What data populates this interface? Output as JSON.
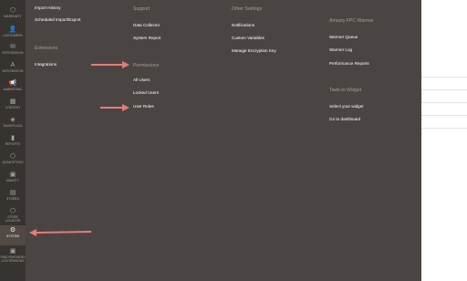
{
  "sidebar": {
    "items": [
      {
        "label": "WARRANTY",
        "icon": "hexagon-icon"
      },
      {
        "label": "CUSTOMERS",
        "icon": "user-icon"
      },
      {
        "label": "INTEGRATION",
        "icon": "integration-icon"
      },
      {
        "label": "INTEGRATION",
        "icon": "amazon-icon"
      },
      {
        "label": "MARKETING",
        "icon": "megaphone-icon"
      },
      {
        "label": "CONTENT",
        "icon": "content-icon"
      },
      {
        "label": "MAGEPLAZA",
        "icon": "mageplaza-icon"
      },
      {
        "label": "REPORTS",
        "icon": "reports-icon"
      },
      {
        "label": "QUANTIFYING",
        "icon": "quantifying-icon"
      },
      {
        "label": "AMASTY",
        "icon": "amasty-icon"
      },
      {
        "label": "STORES",
        "icon": "stores-icon"
      },
      {
        "label": "STORE LOCATOR",
        "icon": "store-locator-icon"
      },
      {
        "label": "SYSTEM",
        "icon": "gear-icon"
      },
      {
        "label": "FIND PARTNERS & EXTENSIONS",
        "icon": "partners-icon"
      }
    ]
  },
  "menu": {
    "col1": {
      "links": [
        "Import History",
        "Scheduled Import/Export"
      ],
      "section_title": "Extensions",
      "section_links": [
        "Integrations"
      ]
    },
    "col2": {
      "title": "Support",
      "links": [
        "Data Collector",
        "System Report"
      ],
      "section_title": "Permissions",
      "section_links": [
        "All Users",
        "Locked Users",
        "User Roles"
      ]
    },
    "col3": {
      "title": "Other Settings",
      "links": [
        "Notifications",
        "Custom Variables",
        "Manage Encryption Key"
      ]
    },
    "col4": {
      "title": "Amasty FPC Warmer",
      "links": [
        "Warmer Queue",
        "Warmer Log",
        "Performance Reports"
      ],
      "section_title": "Tawk.to Widget",
      "section_links": [
        "Select your widget",
        "Go to dashboard"
      ]
    }
  },
  "colors": {
    "sidebar_bg": "#373330",
    "panel_bg": "#4a4542",
    "arrow": "#e87a7a"
  }
}
